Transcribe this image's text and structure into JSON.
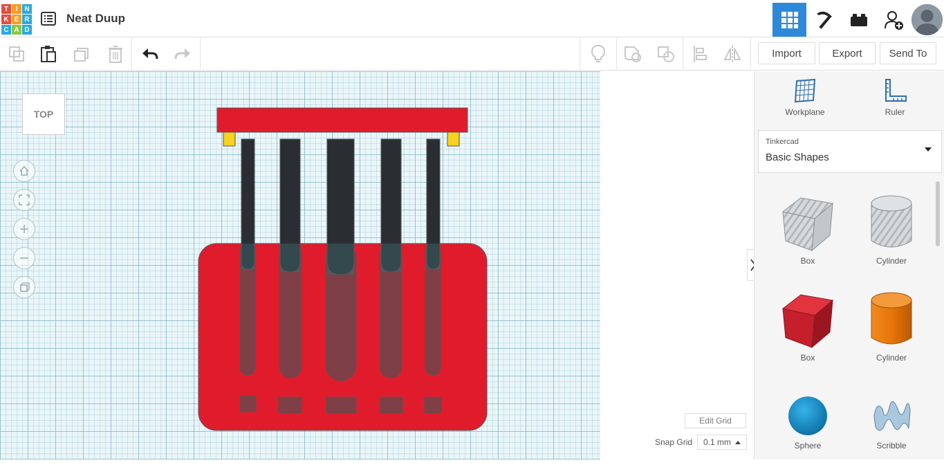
{
  "app": {
    "logo_letters": [
      "T",
      "I",
      "N",
      "K",
      "E",
      "R",
      "C",
      "A",
      "D"
    ],
    "logo_colors": [
      "#e84b3c",
      "#f59e23",
      "#2aa9e0",
      "#e84b3c",
      "#f59e23",
      "#2aa9e0",
      "#2aa9e0",
      "#8cc63f",
      "#2aa9e0"
    ],
    "project_title": "Neat Duup"
  },
  "header": {
    "buttons": [
      {
        "icon": "grid-view-icon",
        "active": true
      },
      {
        "icon": "pickaxe-icon",
        "active": false
      },
      {
        "icon": "bricks-icon",
        "active": false
      },
      {
        "icon": "add-user-icon",
        "active": false
      }
    ]
  },
  "toolbar": {
    "import_label": "Import",
    "export_label": "Export",
    "send_to_label": "Send To"
  },
  "workplane": {
    "viewcube_label": "TOP",
    "edit_grid_label": "Edit Grid",
    "snap_grid_label": "Snap Grid",
    "snap_grid_value": "0.1 mm"
  },
  "panel": {
    "workplane_label": "Workplane",
    "ruler_label": "Ruler",
    "library_category": "Tinkercad",
    "library_name": "Basic Shapes",
    "shapes": [
      {
        "name": "Box",
        "style": "hole"
      },
      {
        "name": "Cylinder",
        "style": "hole"
      },
      {
        "name": "Box",
        "style": "solid"
      },
      {
        "name": "Cylinder",
        "style": "solid"
      },
      {
        "name": "Sphere",
        "style": "solid"
      },
      {
        "name": "Scribble",
        "style": "solid"
      }
    ]
  },
  "colors": {
    "accent": "#2e8ad8",
    "model_red": "#e01c2c",
    "model_dark": "#2a2e33",
    "model_yellow": "#f7d21e"
  }
}
